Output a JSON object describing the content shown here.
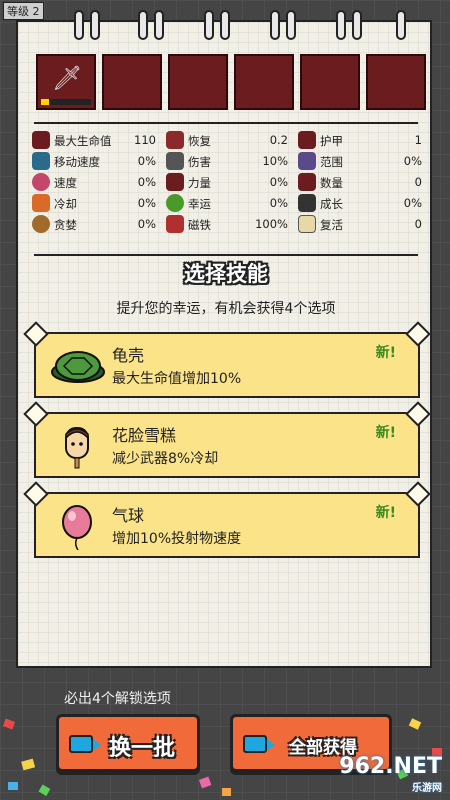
{
  "level_label": "等级 2",
  "weapon_slots": [
    "sword",
    "",
    "",
    "",
    "",
    ""
  ],
  "stats": [
    [
      {
        "label": "最大生命值",
        "value": "110",
        "icon": "heart-icon",
        "color": "#6b1c1f"
      },
      {
        "label": "恢复",
        "value": "0.2",
        "icon": "potion-icon",
        "color": "#8a2a2a"
      },
      {
        "label": "护甲",
        "value": "1",
        "icon": "armor-icon",
        "color": "#6b1c1f"
      }
    ],
    [
      {
        "label": "移动速度",
        "value": "0%",
        "icon": "boots-icon",
        "color": "#2a6a8a"
      },
      {
        "label": "伤害",
        "value": "10%",
        "icon": "dumbbell-icon",
        "color": "#555"
      },
      {
        "label": "范围",
        "value": "0%",
        "icon": "range-icon",
        "color": "#5a4a8a"
      }
    ],
    [
      {
        "label": "速度",
        "value": "0%",
        "icon": "speed-icon",
        "color": "#c2476b"
      },
      {
        "label": "力量",
        "value": "0%",
        "icon": "power-icon",
        "color": "#6b1c1f"
      },
      {
        "label": "数量",
        "value": "0",
        "icon": "count-icon",
        "color": "#6b1c1f"
      }
    ],
    [
      {
        "label": "冷却",
        "value": "0%",
        "icon": "cooldown-icon",
        "color": "#d96a2a"
      },
      {
        "label": "幸运",
        "value": "0%",
        "icon": "clover-icon",
        "color": "#4a9a2a"
      },
      {
        "label": "成长",
        "value": "0%",
        "icon": "growth-icon",
        "color": "#333"
      }
    ],
    [
      {
        "label": "贪婪",
        "value": "0%",
        "icon": "greed-icon",
        "color": "#a06a2a"
      },
      {
        "label": "磁铁",
        "value": "100%",
        "icon": "magnet-icon",
        "color": "#b03030"
      },
      {
        "label": "复活",
        "value": "0",
        "icon": "revive-icon",
        "color": "#e8d8a8"
      }
    ]
  ],
  "title": "选择技能",
  "subtitle": "提升您的幸运，有机会获得4个选项",
  "cards": [
    {
      "name": "龟壳",
      "desc": "最大生命值增加10%",
      "badge": "新!",
      "icon": "turtle-shell-icon"
    },
    {
      "name": "花脸雪糕",
      "desc": "减少武器8%冷却",
      "badge": "新!",
      "icon": "popsicle-icon"
    },
    {
      "name": "气球",
      "desc": "增加10%投射物速度",
      "badge": "新!",
      "icon": "balloon-icon"
    }
  ],
  "bottom_note": "必出4个解锁选项",
  "buttons": {
    "reroll": "换一批",
    "get_all": "全部获得"
  },
  "watermark": {
    "main": "962.NET",
    "sub": "乐游网"
  }
}
